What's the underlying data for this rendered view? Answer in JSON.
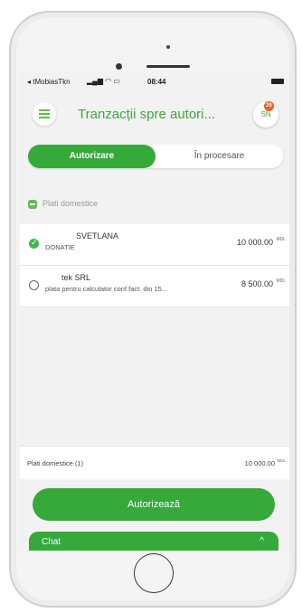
{
  "status": {
    "carrier": "◂ tMobiasTkn",
    "signal": "▂▄▆ ◠ ▭",
    "time": "08:44"
  },
  "header": {
    "title": "Tranzacții spre autori...",
    "avatar": "SN",
    "badge": "26"
  },
  "tabs": [
    {
      "label": "Autorizare"
    },
    {
      "label": "În procesare"
    }
  ],
  "section": {
    "title": "Plati domestice"
  },
  "transactions": [
    {
      "name": "SVETLANA",
      "desc": "DONATIE",
      "amount": "10 000.00",
      "currency": "MDL",
      "checked": true
    },
    {
      "name": "tek SRL",
      "desc": "plata pentru calculator conf.fact. din 15...",
      "amount": "8 500.00",
      "currency": "MDL",
      "checked": false
    }
  ],
  "summary": {
    "label": "Plati domestice (1)",
    "amount": "10 000.00",
    "currency": "MDL"
  },
  "buttons": {
    "authorize": "Autorizează"
  },
  "chat": {
    "label": "Chat",
    "chevron": "^"
  },
  "colors": {
    "accent": "#36a93b",
    "badge": "#f25c24"
  }
}
